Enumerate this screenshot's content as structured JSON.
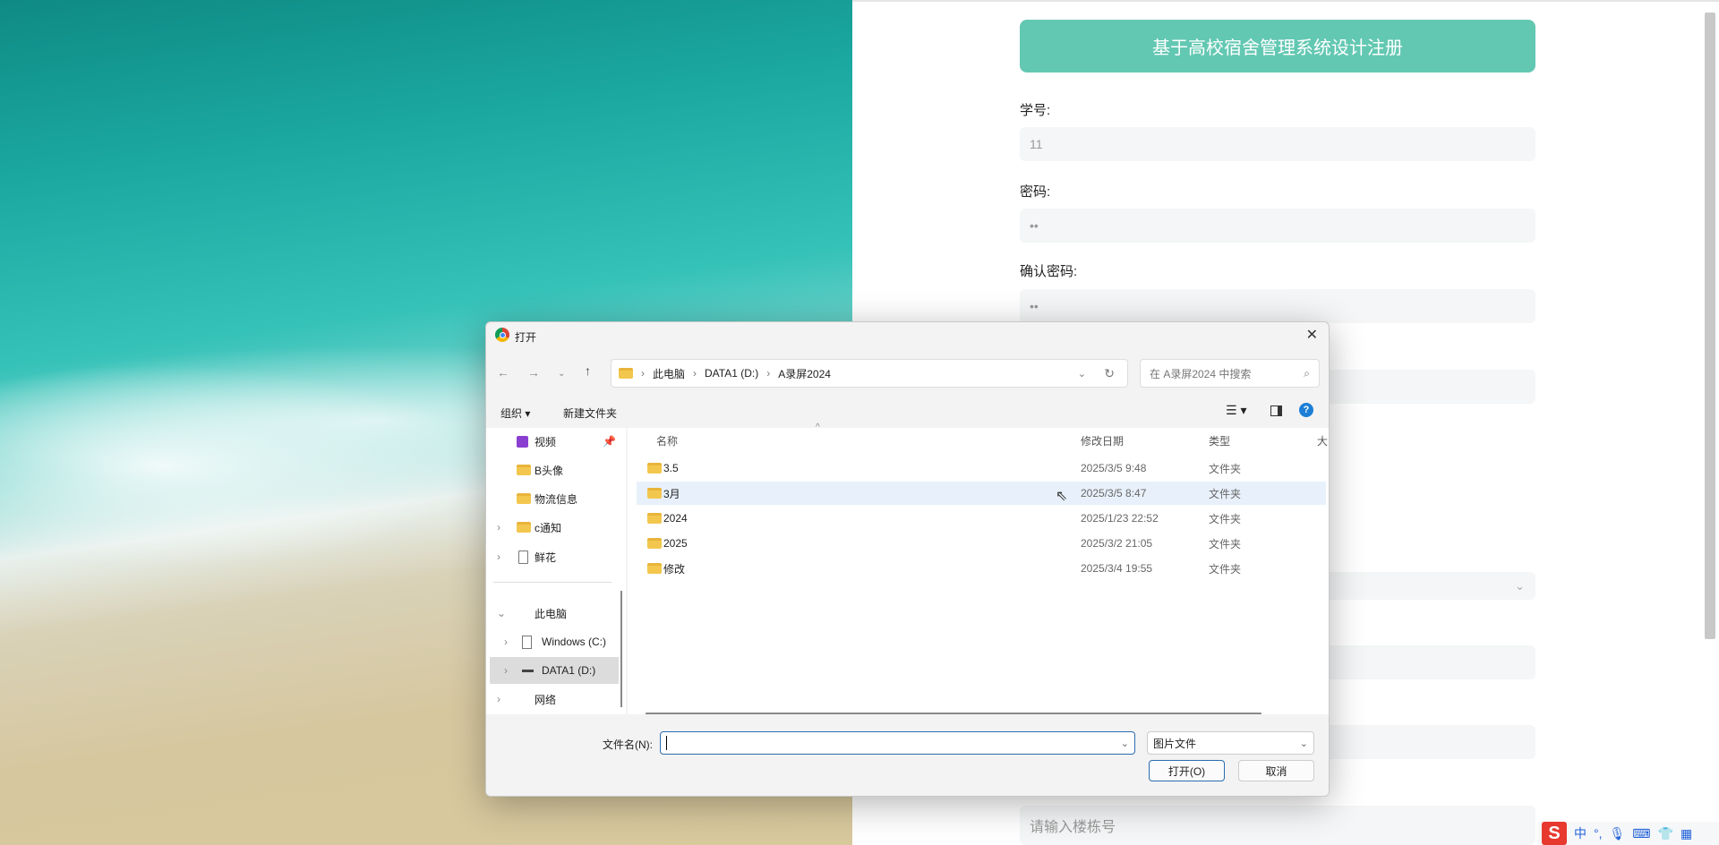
{
  "form": {
    "title": "基于高校宿舍管理系统设计注册",
    "fields": [
      {
        "label": "学号:",
        "value": "11"
      },
      {
        "label": "密码:",
        "value": "••"
      },
      {
        "label": "确认密码:",
        "value": "••"
      }
    ],
    "building_placeholder": "请输入楼栋号"
  },
  "dialog": {
    "title": "打开",
    "breadcrumb": [
      "此电脑",
      "DATA1 (D:)",
      "A录屏2024"
    ],
    "search_placeholder": "在 A录屏2024 中搜索",
    "toolbar": {
      "organize": "组织 ▾",
      "new_folder": "新建文件夹"
    },
    "sidebar": [
      {
        "label": "视频",
        "icon": "video-icon",
        "pinned": true
      },
      {
        "label": "B头像",
        "icon": "folder-icon"
      },
      {
        "label": "物流信息",
        "icon": "folder-icon"
      },
      {
        "label": "c通知",
        "icon": "folder-icon",
        "expandable": true
      },
      {
        "label": "鲜花",
        "icon": "file-icon",
        "expandable": true
      },
      {
        "label": "此电脑",
        "expanded": true
      },
      {
        "label": "Windows (C:)",
        "icon": "drive-icon",
        "expandable": true
      },
      {
        "label": "DATA1 (D:)",
        "icon": "drive-icon",
        "expandable": true,
        "selected": true
      },
      {
        "label": "网络",
        "expandable": true
      }
    ],
    "columns": {
      "name": "名称",
      "date": "修改日期",
      "type": "类型",
      "size": "大"
    },
    "files": [
      {
        "name": "3.5",
        "date": "2025/3/5 9:48",
        "type": "文件夹"
      },
      {
        "name": "3月",
        "date": "2025/3/5 8:47",
        "type": "文件夹",
        "hover": true
      },
      {
        "name": "2024",
        "date": "2025/1/23 22:52",
        "type": "文件夹"
      },
      {
        "name": "2025",
        "date": "2025/3/2 21:05",
        "type": "文件夹"
      },
      {
        "name": "修改",
        "date": "2025/3/4 19:55",
        "type": "文件夹"
      }
    ],
    "filename_label": "文件名(N):",
    "filename_value": "",
    "filter": "图片文件",
    "open_button": "打开(O)",
    "cancel_button": "取消"
  },
  "ime": {
    "mode": "中",
    "punct": "°,"
  },
  "colors": {
    "accent": "#63c8b2",
    "input_bg": "#f4f6f7",
    "selection": "#e8f1fb"
  }
}
